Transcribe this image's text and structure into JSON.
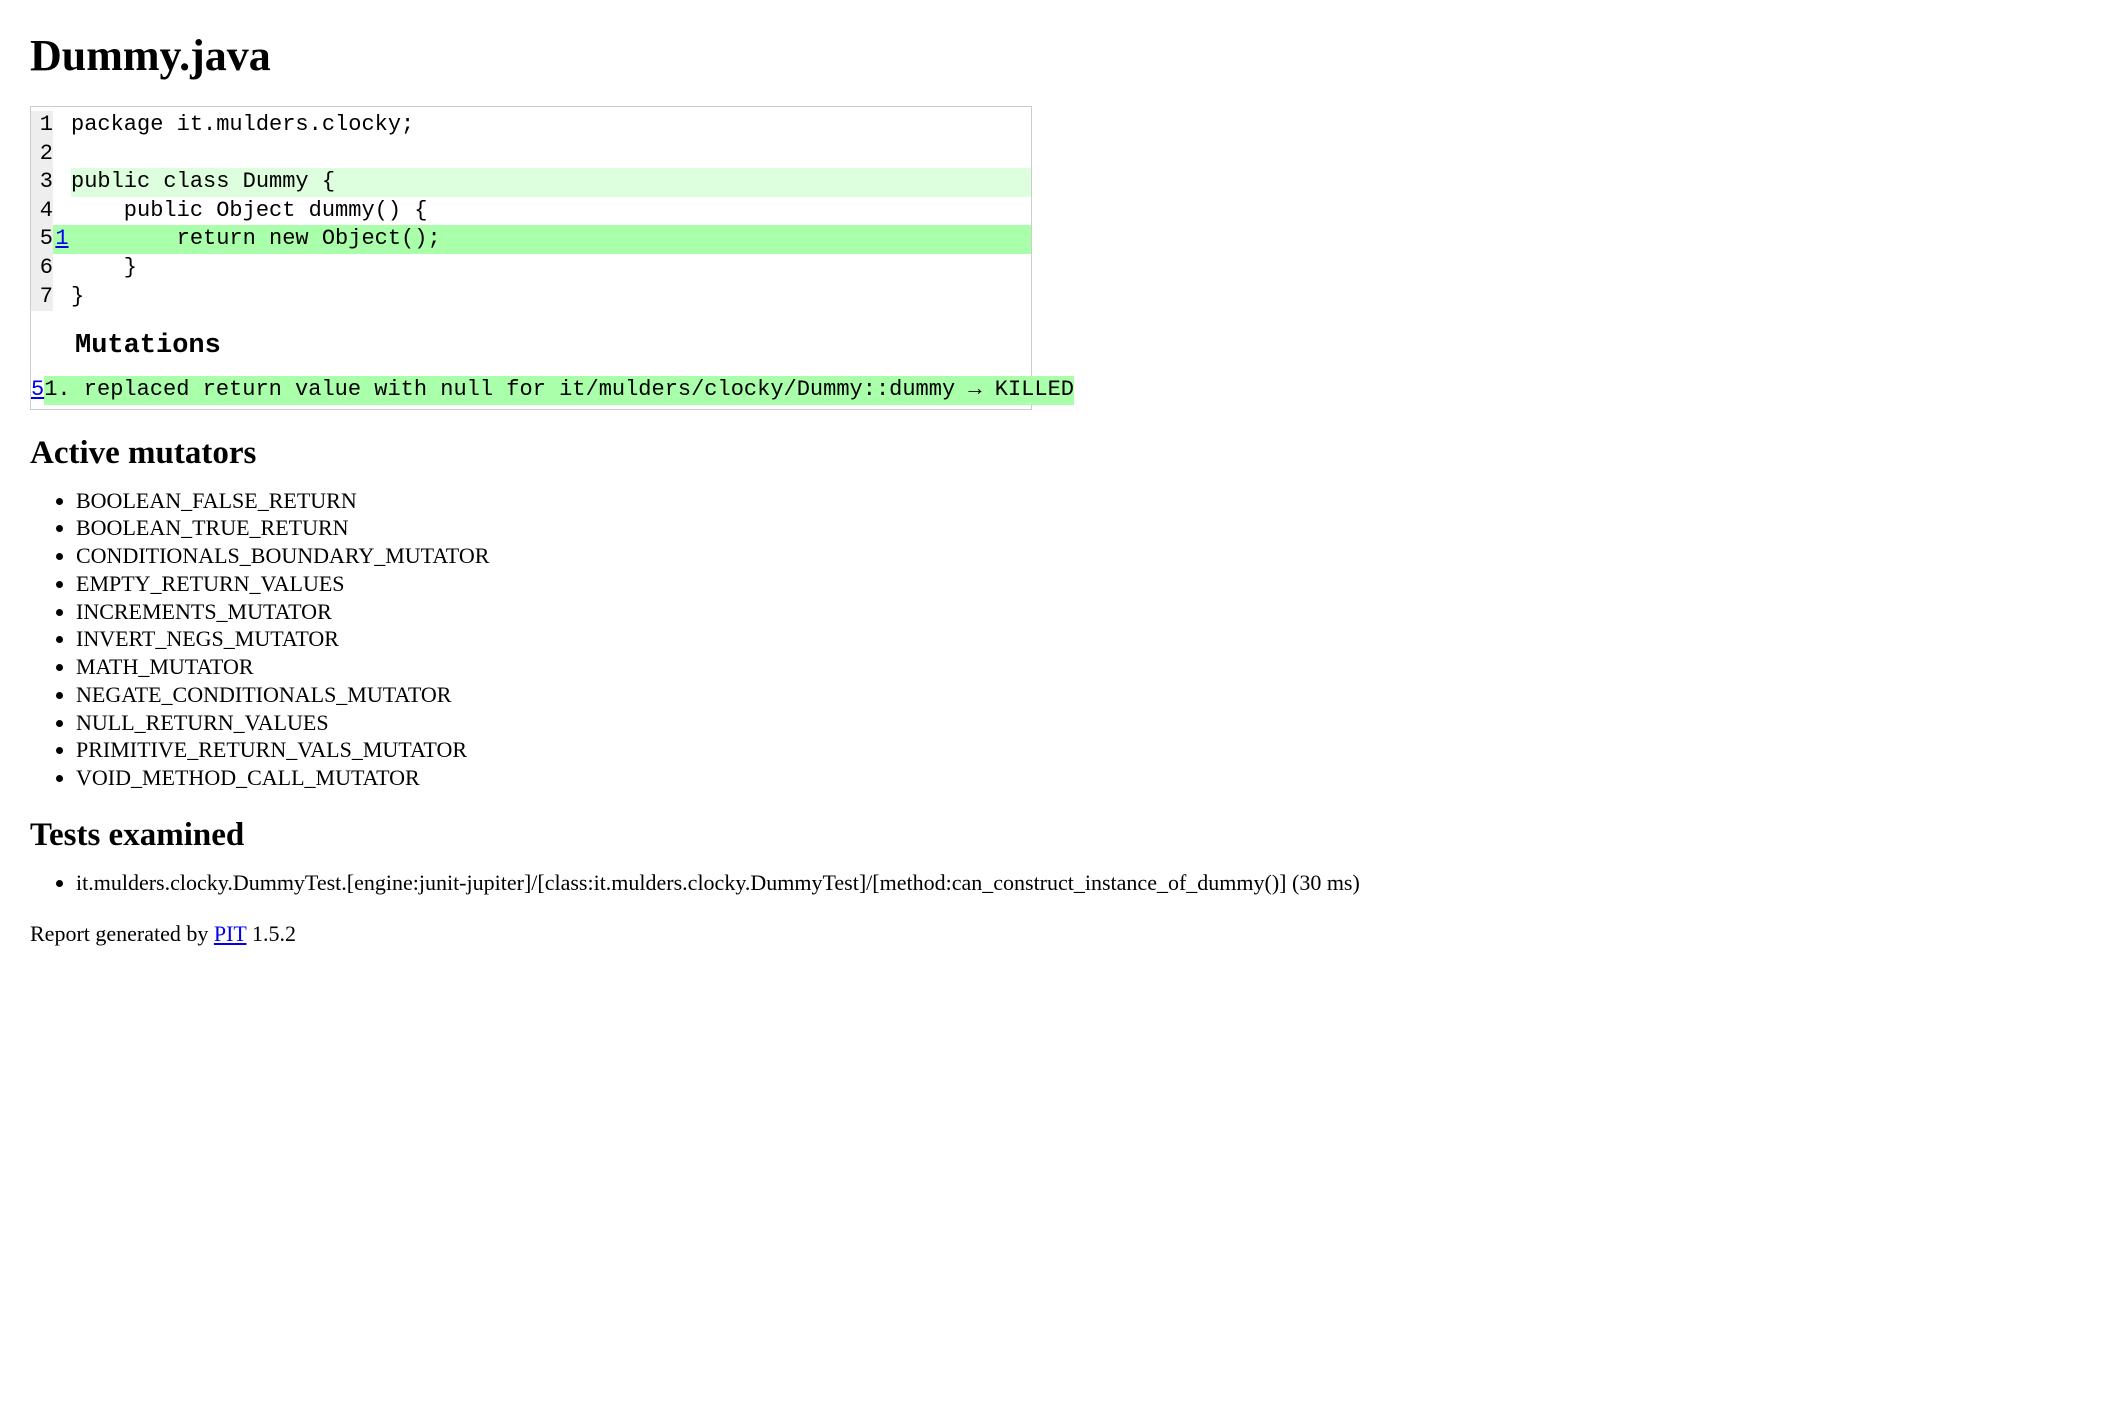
{
  "title": "Dummy.java",
  "source": {
    "lines": [
      {
        "num": "1",
        "covClass": "",
        "covLink": null,
        "code": "package it.mulders.clocky;",
        "codeClass": ""
      },
      {
        "num": "2",
        "covClass": "",
        "covLink": null,
        "code": "",
        "codeClass": ""
      },
      {
        "num": "3",
        "covClass": "",
        "covLink": null,
        "code": "public class Dummy {",
        "codeClass": "covered-light"
      },
      {
        "num": "4",
        "covClass": "",
        "covLink": null,
        "code": "    public Object dummy() {",
        "codeClass": ""
      },
      {
        "num": "5",
        "covClass": "killed",
        "covLink": "1",
        "code": "        return new Object();",
        "codeClass": "killed"
      },
      {
        "num": "6",
        "covClass": "",
        "covLink": null,
        "code": "    }",
        "codeClass": ""
      },
      {
        "num": "7",
        "covClass": "",
        "covLink": null,
        "code": "}",
        "codeClass": ""
      }
    ]
  },
  "mutations": {
    "heading": "Mutations",
    "rows": [
      {
        "line": "5",
        "desc": "1. replaced return value with null for it/mulders/clocky/Dummy::dummy → KILLED",
        "class": "killed"
      }
    ]
  },
  "active_mutators": {
    "heading": "Active mutators",
    "items": [
      "BOOLEAN_FALSE_RETURN",
      "BOOLEAN_TRUE_RETURN",
      "CONDITIONALS_BOUNDARY_MUTATOR",
      "EMPTY_RETURN_VALUES",
      "INCREMENTS_MUTATOR",
      "INVERT_NEGS_MUTATOR",
      "MATH_MUTATOR",
      "NEGATE_CONDITIONALS_MUTATOR",
      "NULL_RETURN_VALUES",
      "PRIMITIVE_RETURN_VALS_MUTATOR",
      "VOID_METHOD_CALL_MUTATOR"
    ]
  },
  "tests_examined": {
    "heading": "Tests examined",
    "items": [
      "it.mulders.clocky.DummyTest.[engine:junit-jupiter]/[class:it.mulders.clocky.DummyTest]/[method:can_construct_instance_of_dummy()] (30 ms)"
    ]
  },
  "footer": {
    "prefix": "Report generated by ",
    "link_text": "PIT",
    "suffix": " 1.5.2"
  }
}
